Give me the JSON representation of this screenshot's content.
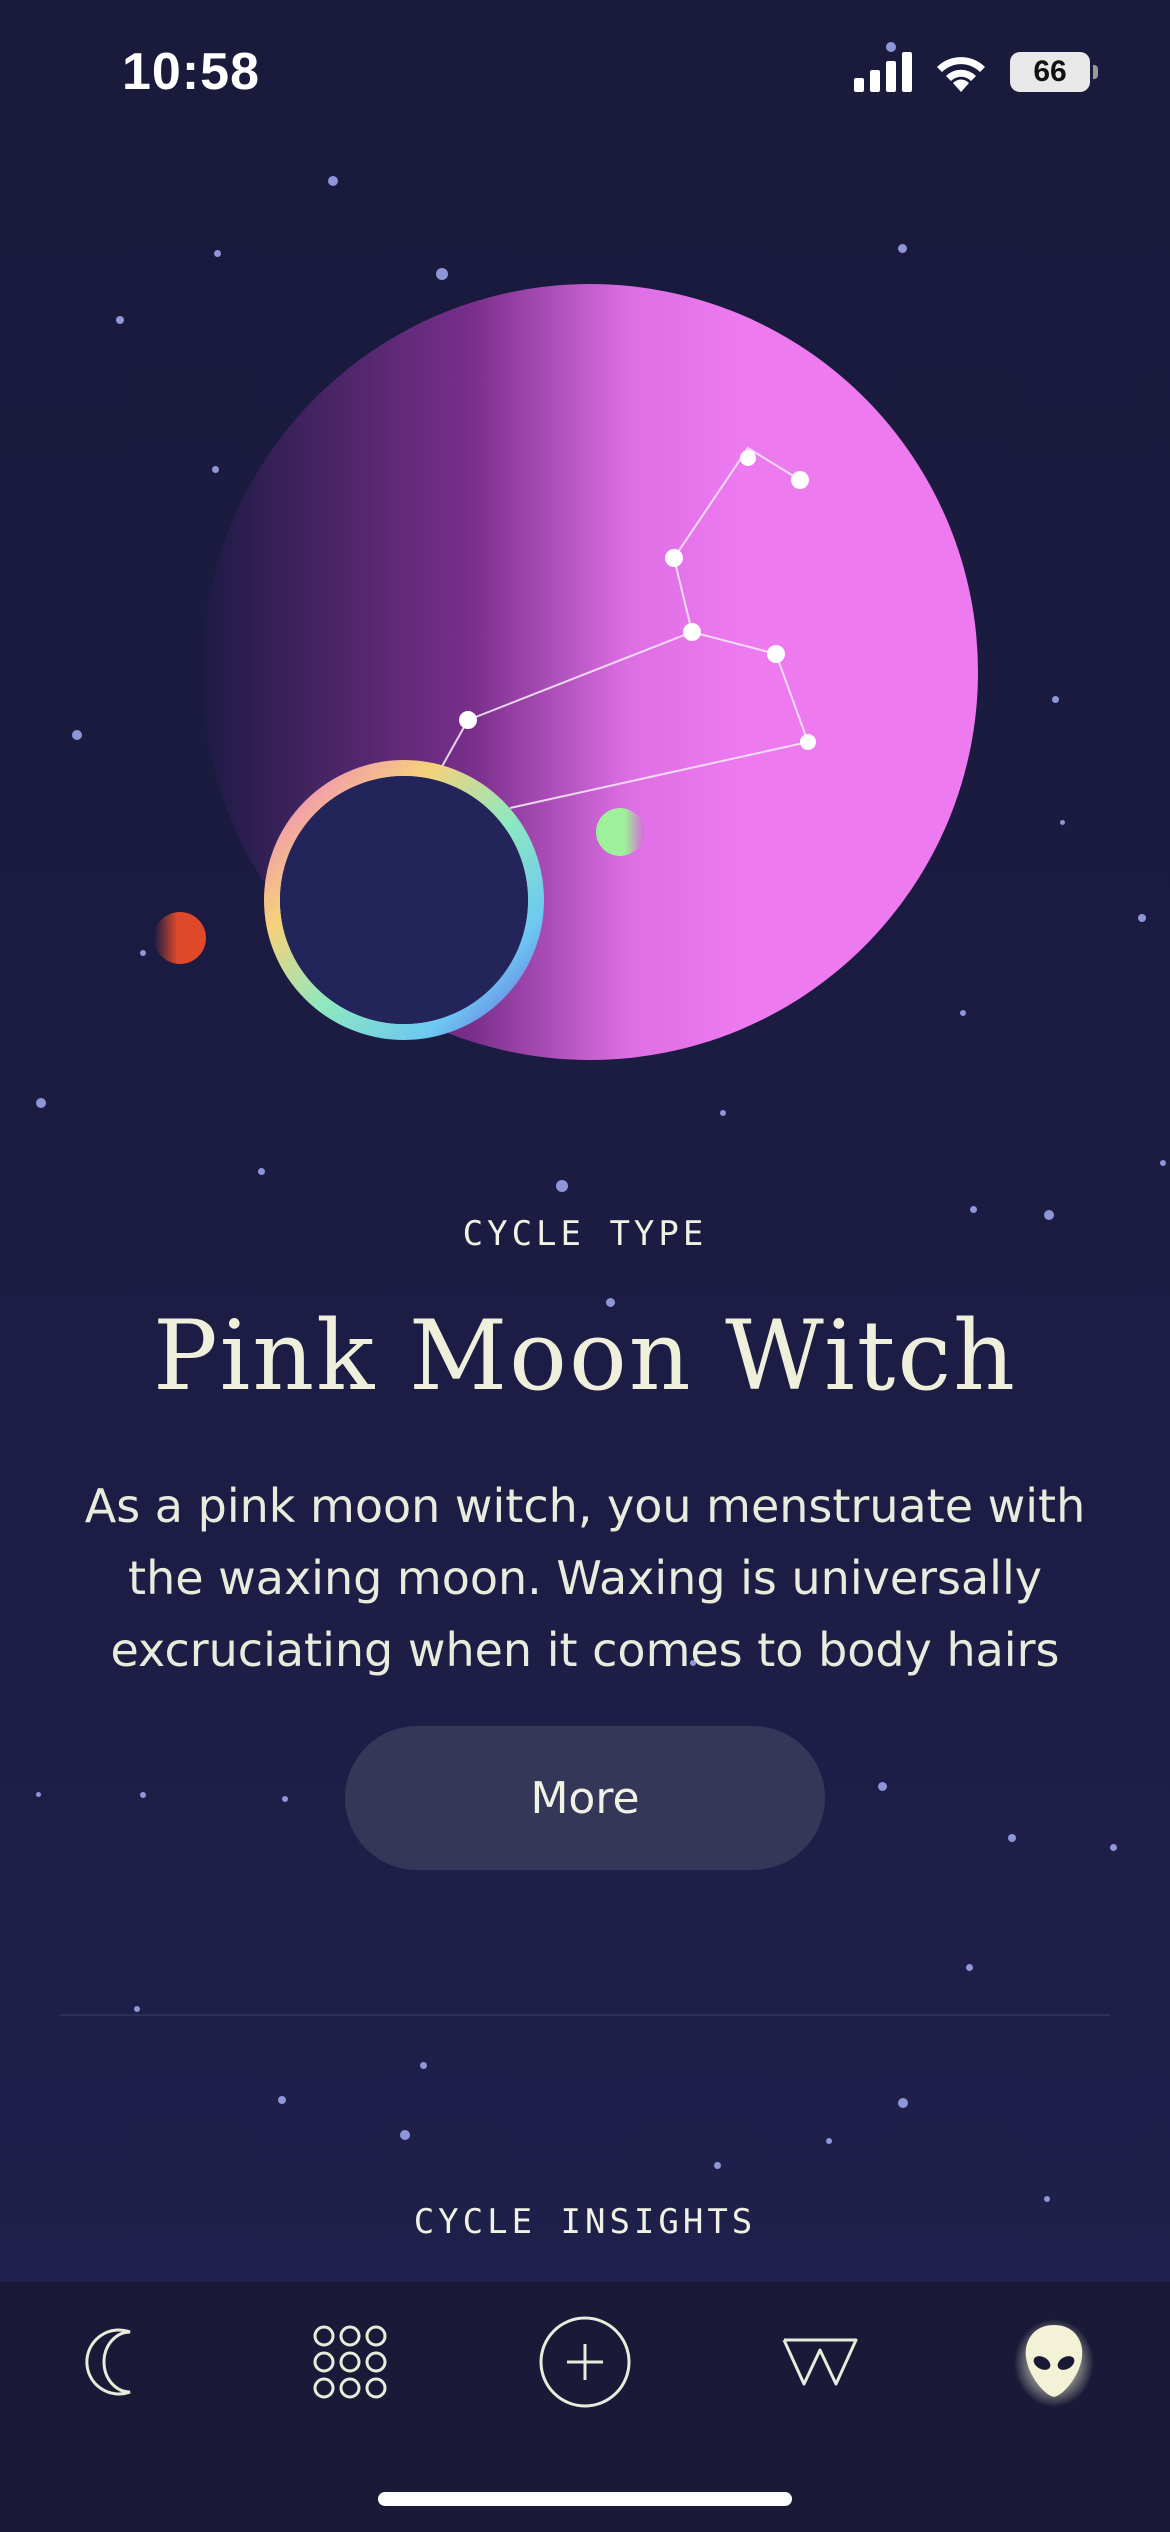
{
  "status_bar": {
    "time": "10:58",
    "battery": "66"
  },
  "cycle_type": {
    "label": "CYCLE TYPE",
    "title": "Pink Moon Witch",
    "description_lines": [
      "As a pink moon witch, you menstruate with",
      "the waxing moon. Waxing is universally",
      "excruciating when it comes to body hairs"
    ],
    "more_button": "More"
  },
  "cycle_insights": {
    "label": "CYCLE INSIGHTS"
  },
  "tab_bar": {
    "items": [
      {
        "icon": "moon-icon"
      },
      {
        "icon": "grid-dots-icon"
      },
      {
        "icon": "add-circle-icon"
      },
      {
        "icon": "w-logo-icon"
      },
      {
        "icon": "alien-icon"
      }
    ]
  },
  "colors": {
    "background": "#1c1c44",
    "planet_pink": "#ee7af0",
    "text": "#eef0dc",
    "button": "#353758"
  }
}
